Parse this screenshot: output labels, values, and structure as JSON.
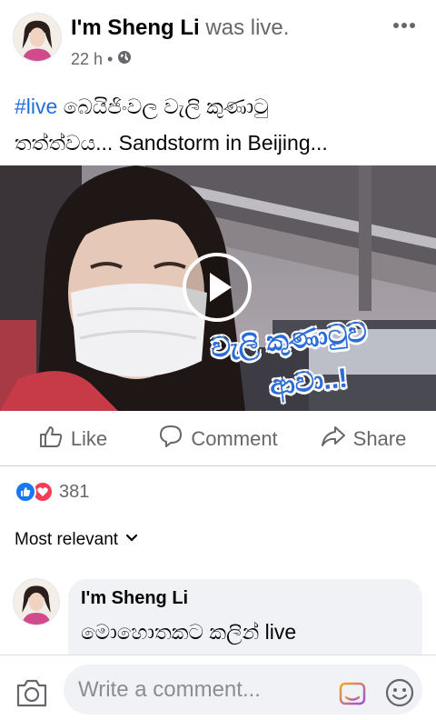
{
  "post": {
    "author": "I'm Sheng Li",
    "status": "was live.",
    "time": "22 h",
    "dot": "•",
    "hashtag": "#live",
    "text_line1": "බෙයිජිංවල වැලි කුණාටු",
    "text_line2": "තත්ත්වය... Sandstorm in Beijing..."
  },
  "video": {
    "caption_line1": "වැලි කුණාටුව",
    "caption_line2": "ආවා..!"
  },
  "actions": {
    "like": "Like",
    "comment": "Comment",
    "share": "Share"
  },
  "reactions": {
    "count": "381",
    "types": [
      "like",
      "love"
    ]
  },
  "sort": {
    "label": "Most relevant"
  },
  "comment": {
    "author": "I'm Sheng Li",
    "text": "මොහොතකට කලින් live"
  },
  "composer": {
    "placeholder": "Write a comment..."
  },
  "colors": {
    "accent": "#216fdb",
    "like": "#1877f2",
    "love": "#f33e58",
    "secondary_text": "#65676b",
    "bubble": "#f0f2f5"
  },
  "icons": [
    "more-icon",
    "globe-icon",
    "play-icon",
    "like-icon",
    "comment-icon",
    "share-icon",
    "chevron-down-icon",
    "camera-icon",
    "gif-icon",
    "emoji-icon"
  ]
}
